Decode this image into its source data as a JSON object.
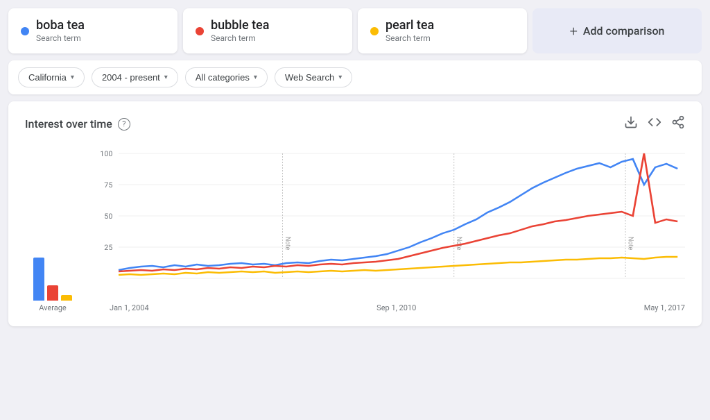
{
  "search_terms": [
    {
      "id": "boba-tea",
      "name": "boba tea",
      "label": "Search term",
      "color": "#4285F4"
    },
    {
      "id": "bubble-tea",
      "name": "bubble tea",
      "label": "Search term",
      "color": "#EA4335"
    },
    {
      "id": "pearl-tea",
      "name": "pearl tea",
      "label": "Search term",
      "color": "#FBBC04"
    }
  ],
  "add_comparison": {
    "label": "Add comparison",
    "plus": "+"
  },
  "filters": [
    {
      "id": "location",
      "label": "California",
      "icon": "▾"
    },
    {
      "id": "date",
      "label": "2004 - present",
      "icon": "▾"
    },
    {
      "id": "categories",
      "label": "All categories",
      "icon": "▾"
    },
    {
      "id": "search-type",
      "label": "Web Search",
      "icon": "▾"
    }
  ],
  "chart": {
    "title": "Interest over time",
    "help_icon": "?",
    "y_labels": [
      "100",
      "75",
      "50",
      "25"
    ],
    "x_labels": [
      "Jan 1, 2004",
      "Sep 1, 2010",
      "May 1, 2017"
    ],
    "note_labels": [
      "Note",
      "Note",
      "Note"
    ],
    "avg_label": "Average",
    "actions": {
      "download": "⬇",
      "embed": "<>",
      "share": "⇪"
    }
  },
  "avg_bars": [
    {
      "color": "#4285F4",
      "height_pct": 78
    },
    {
      "color": "#EA4335",
      "height_pct": 28
    },
    {
      "color": "#FBBC04",
      "height_pct": 10
    }
  ]
}
